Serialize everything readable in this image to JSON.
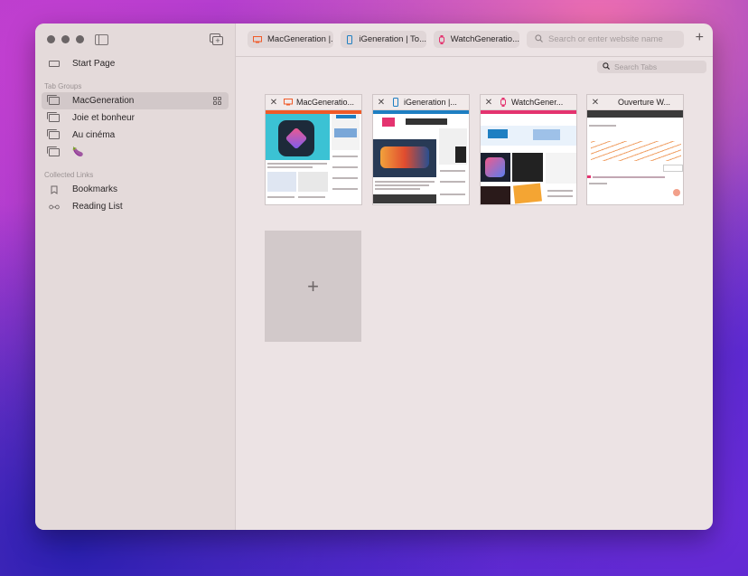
{
  "sidebar": {
    "start_page": "Start Page",
    "tab_groups_heading": "Tab Groups",
    "groups": [
      {
        "label": "MacGeneration",
        "active": true
      },
      {
        "label": "Joie et bonheur"
      },
      {
        "label": "Au cinéma"
      },
      {
        "label": "🍆"
      }
    ],
    "collected_heading": "Collected Links",
    "links": [
      {
        "label": "Bookmarks",
        "icon": "bookmark-icon"
      },
      {
        "label": "Reading List",
        "icon": "glasses-icon"
      }
    ]
  },
  "toolbar": {
    "tabs": [
      {
        "label": "MacGeneration |..."
      },
      {
        "label": "iGeneration | To..."
      },
      {
        "label": "WatchGeneratio..."
      }
    ],
    "url_placeholder": "Search or enter website name"
  },
  "overview": {
    "search_placeholder": "Search Tabs",
    "cards": [
      {
        "title": "MacGeneratio..."
      },
      {
        "title": "iGeneration |..."
      },
      {
        "title": "WatchGener..."
      },
      {
        "title": "Ouverture W..."
      }
    ],
    "new_tab_symbol": "+"
  },
  "colors": {
    "mac_orange": "#f05a28",
    "igen_blue": "#1e7fc2",
    "watch_pink": "#e4336f",
    "shortcuts_gradient": "#d94fa8"
  }
}
